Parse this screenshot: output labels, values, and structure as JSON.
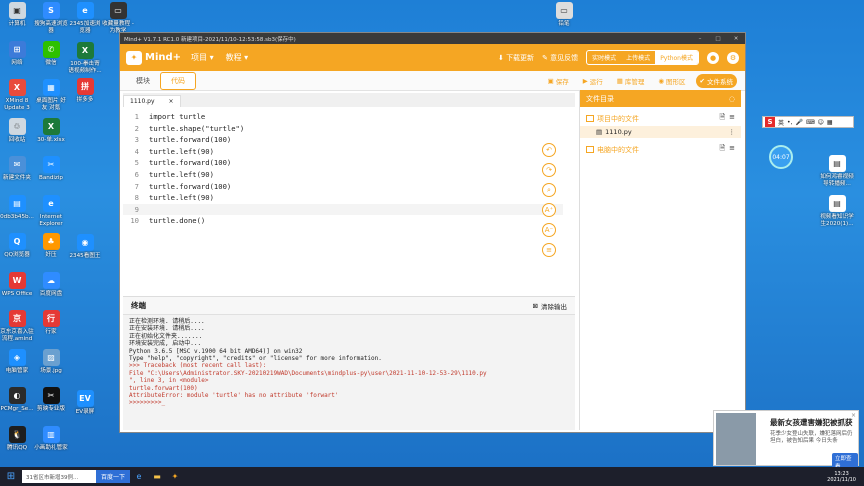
{
  "desktop_left": [
    {
      "label": "计算机",
      "color": "#cfd8e0",
      "glyph": "▣",
      "icon": "computer-icon"
    },
    {
      "label": "网络",
      "color": "#3c7bd9",
      "glyph": "⊞",
      "icon": "network-icon"
    },
    {
      "label": "XMind 8 Update 3",
      "color": "#e84b3c",
      "glyph": "X",
      "icon": "xmind-icon"
    },
    {
      "label": "回收站",
      "color": "#cfd8e0",
      "glyph": "♲",
      "icon": "recycle-bin-icon"
    },
    {
      "label": "新建文件夹",
      "color": "#4a90d9",
      "glyph": "✉",
      "icon": "mail-icon"
    },
    {
      "label": "0db3b45b...",
      "color": "#1e90ff",
      "glyph": "▤",
      "icon": "file-icon"
    },
    {
      "label": "QQ浏览器",
      "color": "#1e90ff",
      "glyph": "Q",
      "icon": "qq-browser-icon"
    },
    {
      "label": "WPS Office",
      "color": "#e53935",
      "glyph": "W",
      "icon": "wps-icon"
    },
    {
      "label": "京东京喜入驻流程.amind",
      "color": "#e53935",
      "glyph": "京",
      "icon": "amind-file-icon"
    },
    {
      "label": "电脑管家",
      "color": "#1e90ff",
      "glyph": "◈",
      "icon": "pc-manager-icon"
    },
    {
      "label": "PCMgr_Se...",
      "color": "#2b2b2b",
      "glyph": "◐",
      "icon": "pcmgr-icon"
    },
    {
      "label": "腾讯QQ",
      "color": "#1e1e1e",
      "glyph": "🐧",
      "icon": "qq-icon"
    }
  ],
  "desktop_col2": [
    {
      "label": "搜狗高速浏览器",
      "color": "#2f8cff",
      "glyph": "S",
      "icon": "sogou-browser-icon"
    },
    {
      "label": "微信",
      "color": "#2dc100",
      "glyph": "✆",
      "icon": "wechat-icon"
    },
    {
      "label": "桌面图片 好友 对氪",
      "color": "#1e90ff",
      "glyph": "▦",
      "icon": "image-folder-icon"
    },
    {
      "label": "30-单.xlsx",
      "color": "#1d7a3a",
      "glyph": "X",
      "icon": "excel-icon"
    },
    {
      "label": "Bandizip",
      "color": "#1e90ff",
      "glyph": "✂",
      "icon": "bandizip-icon"
    },
    {
      "label": "Internet Explorer",
      "color": "#1e90ff",
      "glyph": "e",
      "icon": "ie-icon"
    },
    {
      "label": "好压",
      "color": "#ff9800",
      "glyph": "♣",
      "icon": "haozip-icon"
    },
    {
      "label": "百度网盘",
      "color": "#2f8cff",
      "glyph": "☁",
      "icon": "baidu-pan-icon"
    },
    {
      "label": "行家",
      "color": "#e53935",
      "glyph": "行",
      "icon": "hangjia-icon"
    },
    {
      "label": "场景.jpg",
      "color": "#6aa0d0",
      "glyph": "▨",
      "icon": "jpg-file-icon"
    },
    {
      "label": "剪映专业版",
      "color": "#111",
      "glyph": "✂",
      "icon": "jianying-icon"
    },
    {
      "label": "小画助礼管家",
      "color": "#2f8cff",
      "glyph": "▥",
      "icon": "assistant-icon"
    }
  ],
  "desktop_col3": [
    {
      "label": "2345加速浏览器",
      "color": "#1e90ff",
      "glyph": "e",
      "icon": "2345-browser-icon"
    },
    {
      "label": "100-拳击寄语视频制作...",
      "color": "#1d7a3a",
      "glyph": "X",
      "icon": "excel-file-icon"
    },
    {
      "label": "拼多多",
      "color": "#e53935",
      "glyph": "拼",
      "icon": "pinduoduo-icon"
    },
    {
      "label": "2345看图王",
      "color": "#1e90ff",
      "glyph": "◉",
      "icon": "2345-viewer-icon"
    },
    {
      "label": "EV录屏",
      "color": "#1e90ff",
      "glyph": "EV",
      "icon": "ev-recorder-icon"
    }
  ],
  "desktop_extra": [
    {
      "label": "收藏量教程 - 为教学",
      "color": "#333",
      "glyph": "▭",
      "icon": "tutorial-file-icon"
    },
    {
      "label": "铅笔",
      "color": "#ddd",
      "glyph": "▭",
      "icon": "pencil-file-icon"
    }
  ],
  "desktop_right": [
    {
      "label": "如何鸿睿视频导转播频...",
      "color": "#fff",
      "glyph": "▤",
      "icon": "doc-file-icon"
    },
    {
      "label": "视频看知识学生2020(1)...",
      "color": "#fff",
      "glyph": "▤",
      "icon": "doc-file-icon-2"
    }
  ],
  "window": {
    "title": "Mind+ V1.7.1 RC1.0   新建项目-2021/11/10-12:53:58.sb3(保存中)",
    "logo": "Mind+",
    "menus": [
      "项目 ▾",
      "教程 ▾"
    ],
    "download": "下载更新",
    "feedback": "意见反馈",
    "modes": [
      "实时模式",
      "上传模式",
      "Python模式"
    ],
    "active_mode": "Python模式"
  },
  "toolbar": {
    "tabs": [
      "模块",
      "代码"
    ],
    "active_tab": "代码",
    "save": "保存",
    "run": "运行",
    "library": "库管理",
    "graphic": "图形区",
    "filesystem": "文件系统"
  },
  "editor": {
    "file_tab": "1110.py",
    "close": "×",
    "lines": [
      {
        "n": "1",
        "code": "import turtle"
      },
      {
        "n": "2",
        "code": "turtle.shape(\"turtle\")"
      },
      {
        "n": "3",
        "code": "turtle.forward(100)"
      },
      {
        "n": "4",
        "code": "turtle.left(90)"
      },
      {
        "n": "5",
        "code": "turtle.forward(100)"
      },
      {
        "n": "6",
        "code": "turtle.left(90)"
      },
      {
        "n": "7",
        "code": "turtle.forward(100)"
      },
      {
        "n": "8",
        "code": "turtle.left(90)"
      },
      {
        "n": "9",
        "code": ""
      },
      {
        "n": "10",
        "code": "turtle.done()"
      }
    ]
  },
  "terminal": {
    "title": "终端",
    "clear": "清除输出",
    "lines": [
      {
        "t": "正在检测环境. 请稍后....",
        "err": false
      },
      {
        "t": "正在安装环境. 请稍后....",
        "err": false
      },
      {
        "t": "正在初始化文件夹.......",
        "err": false
      },
      {
        "t": "环境安装完成, 启动中...",
        "err": false
      },
      {
        "t": "Python 3.6.5  [MSC v.1900 64 bit AMD64)] on win32",
        "err": false
      },
      {
        "t": "Type \"help\", \"copyright\", \"credits\" or \"license\" for more information.",
        "err": false
      },
      {
        "t": ">>> Traceback (most recent call last):",
        "err": true
      },
      {
        "t": "  File \"C:\\Users\\Administrator.SKY-20210219WAD\\Documents\\mindplus-py\\user\\2021-11-10-12-53-29\\1110.py",
        "err": true
      },
      {
        "t": "\", line 3, in <module>",
        "err": true
      },
      {
        "t": "    turtle.forwart(100)",
        "err": true
      },
      {
        "t": "AttributeError: module 'turtle' has no attribute 'forwart'",
        "err": true
      },
      {
        "t": ">>>>>>>>>_",
        "err": true
      }
    ]
  },
  "files": {
    "header": "文件目录",
    "project_section": "项目中的文件",
    "file": "1110.py",
    "pc_section": "电脑中的文件"
  },
  "taskbar": {
    "search": "31省区市新增39例...",
    "search_btn": "百度一下",
    "time": "13:23",
    "date": "2021/11/10"
  },
  "popup": {
    "title": "最新女孩遭害嫌犯被抓获",
    "desc": "花季少女登山失联，嫌犯落网后仍坦白，被告知后果 今日头条",
    "button": "立即查看",
    "close": "×"
  },
  "ime": {
    "label": "英"
  },
  "bubble": "04:07",
  "colors": {
    "accent": "#f5a623",
    "desktop": "#1e7fd6",
    "error": "#c0392b"
  }
}
